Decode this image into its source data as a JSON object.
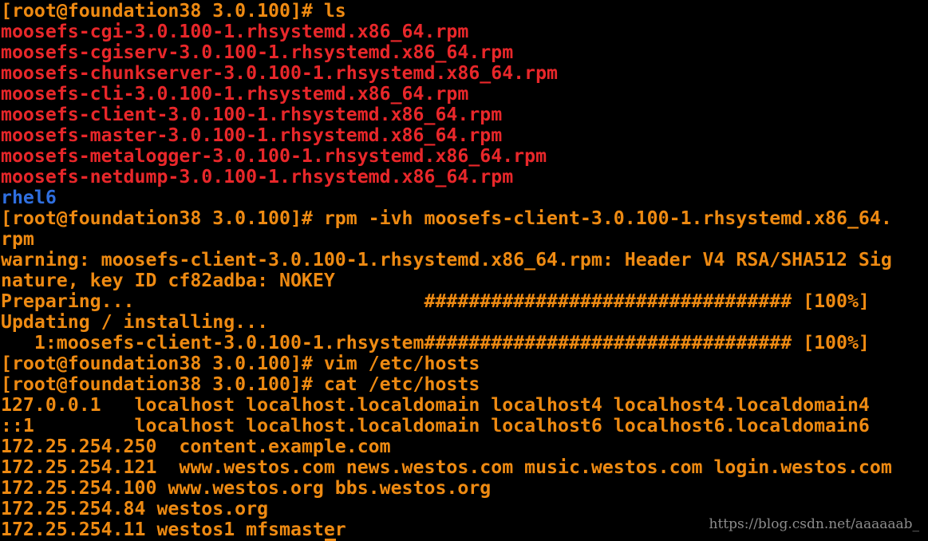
{
  "terminal": {
    "colors": {
      "background": "#000000",
      "prompt_output": "#ee8a12",
      "rpm_file": "#e8272a",
      "directory": "#2f6fe0",
      "watermark": "#8c8c8c"
    },
    "lines": [
      {
        "text": "[root@foundation38 3.0.100]# ls",
        "kind": "prompt"
      },
      {
        "text": "moosefs-cgi-3.0.100-1.rhsystemd.x86_64.rpm",
        "kind": "rpm"
      },
      {
        "text": "moosefs-cgiserv-3.0.100-1.rhsystemd.x86_64.rpm",
        "kind": "rpm"
      },
      {
        "text": "moosefs-chunkserver-3.0.100-1.rhsystemd.x86_64.rpm",
        "kind": "rpm"
      },
      {
        "text": "moosefs-cli-3.0.100-1.rhsystemd.x86_64.rpm",
        "kind": "rpm"
      },
      {
        "text": "moosefs-client-3.0.100-1.rhsystemd.x86_64.rpm",
        "kind": "rpm"
      },
      {
        "text": "moosefs-master-3.0.100-1.rhsystemd.x86_64.rpm",
        "kind": "rpm"
      },
      {
        "text": "moosefs-metalogger-3.0.100-1.rhsystemd.x86_64.rpm",
        "kind": "rpm"
      },
      {
        "text": "moosefs-netdump-3.0.100-1.rhsystemd.x86_64.rpm",
        "kind": "rpm"
      },
      {
        "text": "rhel6",
        "kind": "dir"
      },
      {
        "text": "[root@foundation38 3.0.100]# rpm -ivh moosefs-client-3.0.100-1.rhsystemd.x86_64.",
        "kind": "prompt"
      },
      {
        "text": "rpm",
        "kind": "output"
      },
      {
        "text": "warning: moosefs-client-3.0.100-1.rhsystemd.x86_64.rpm: Header V4 RSA/SHA512 Sig",
        "kind": "output"
      },
      {
        "text": "nature, key ID cf82adba: NOKEY",
        "kind": "output"
      },
      {
        "text": "Preparing...                          ################################# [100%]",
        "kind": "output"
      },
      {
        "text": "Updating / installing...",
        "kind": "output"
      },
      {
        "text": "   1:moosefs-client-3.0.100-1.rhsystem################################# [100%]",
        "kind": "output"
      },
      {
        "text": "[root@foundation38 3.0.100]# vim /etc/hosts",
        "kind": "prompt"
      },
      {
        "text": "[root@foundation38 3.0.100]# cat /etc/hosts",
        "kind": "prompt"
      },
      {
        "text": "127.0.0.1   localhost localhost.localdomain localhost4 localhost4.localdomain4",
        "kind": "output"
      },
      {
        "text": "::1         localhost localhost.localdomain localhost6 localhost6.localdomain6",
        "kind": "output"
      },
      {
        "text": "172.25.254.250  content.example.com",
        "kind": "output"
      },
      {
        "text": "172.25.254.121  www.westos.com news.westos.com music.westos.com login.westos.com",
        "kind": "output"
      },
      {
        "text": "172.25.254.100 www.westos.org bbs.westos.org",
        "kind": "output"
      },
      {
        "text": "172.25.254.84 westos.org",
        "kind": "output"
      },
      {
        "text": "172.25.254.11 westos1 mfsmaster",
        "kind": "output"
      }
    ]
  },
  "watermark": "https://blog.csdn.net/aaaaaab_"
}
